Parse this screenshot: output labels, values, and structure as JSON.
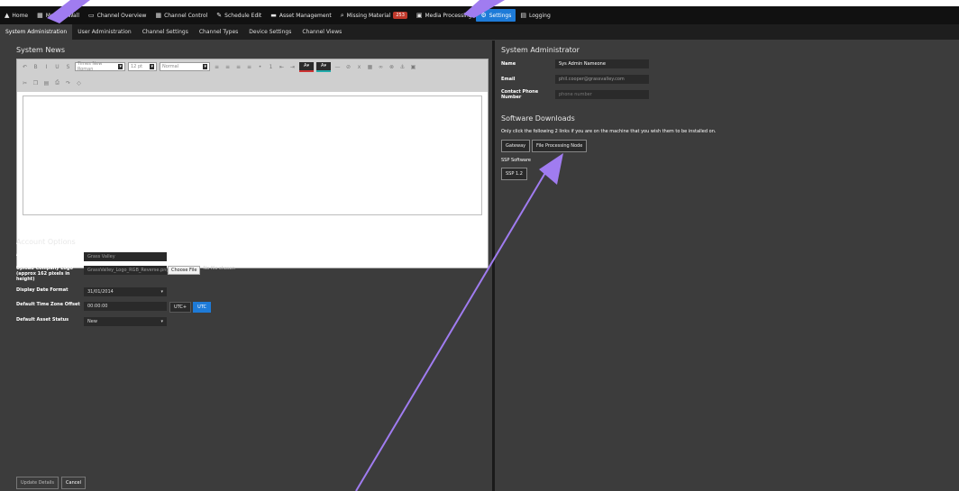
{
  "topnav": [
    {
      "icon": "home-icon",
      "glyph": "▲",
      "label": "Home"
    },
    {
      "icon": "grid-icon",
      "glyph": "▦",
      "label": "Monitor Wall"
    },
    {
      "icon": "screen-icon",
      "glyph": "▭",
      "label": "Channel Overview"
    },
    {
      "icon": "grid-icon",
      "glyph": "▦",
      "label": "Channel Control"
    },
    {
      "icon": "edit-icon",
      "glyph": "✎",
      "label": "Schedule Edit"
    },
    {
      "icon": "folder-icon",
      "glyph": "▬",
      "label": "Asset Management"
    },
    {
      "icon": "search-icon",
      "glyph": "⌕",
      "label": "Missing Material",
      "badge": "253"
    },
    {
      "icon": "film-icon",
      "glyph": "▣",
      "label": "Media Processing"
    },
    {
      "icon": "gear-icon",
      "glyph": "⚙",
      "label": "Settings",
      "active": true
    },
    {
      "icon": "list-icon",
      "glyph": "▤",
      "label": "Logging"
    }
  ],
  "subnav": [
    {
      "label": "System Administration",
      "active": true
    },
    {
      "label": "User Administration"
    },
    {
      "label": "Channel Settings"
    },
    {
      "label": "Channel Types"
    },
    {
      "label": "Device Settings"
    },
    {
      "label": "Channel Views"
    }
  ],
  "left": {
    "system_news": "System News",
    "editor": {
      "font_family_placeholder": "Times New Roman",
      "font_size": "12 pt",
      "format": "Normal",
      "color_a": "A",
      "color_b": "A"
    },
    "account_options": "Account Options",
    "fields": {
      "account_name_label": "Account Full Name",
      "account_name_value": "Grass Valley",
      "logo_label": "Upload Company Logo (approx 162 pixels in height)",
      "logo_value": "GrassValley_Logo_RGB_Reverse.png",
      "choose_file": "Choose File",
      "no_file": "No file chosen",
      "date_format_label": "Display Date Format",
      "date_format_value": "31/01/2014",
      "tz_label": "Default Time Zone Offset",
      "tz_value": "00:00:00",
      "utc_plus": "UTC+",
      "utc": "UTC",
      "asset_status_label": "Default Asset Status",
      "asset_status_value": "New"
    },
    "update_details": "Update Details",
    "cancel": "Cancel"
  },
  "right": {
    "sysadmin_title": "System Administrator",
    "name_label": "Name",
    "name_value": "Sys Admin Nameone",
    "email_label": "Email",
    "email_value": "phil.cooper@grassvalley.com",
    "phone_label": "Contact Phone Number",
    "phone_placeholder": "phone number",
    "downloads_title": "Software Downloads",
    "downloads_note": "Only click the following 2 links if you are on the machine that you wish them to be installed on.",
    "gateway": "Gateway",
    "file_processing": "File Processing Node",
    "ssp_label": "SSP Software",
    "ssp_btn": "SSP 1.2"
  },
  "colors": {
    "accent": "#1e7bd8",
    "badge": "#c0392b",
    "annotation": "#a07cf0"
  }
}
